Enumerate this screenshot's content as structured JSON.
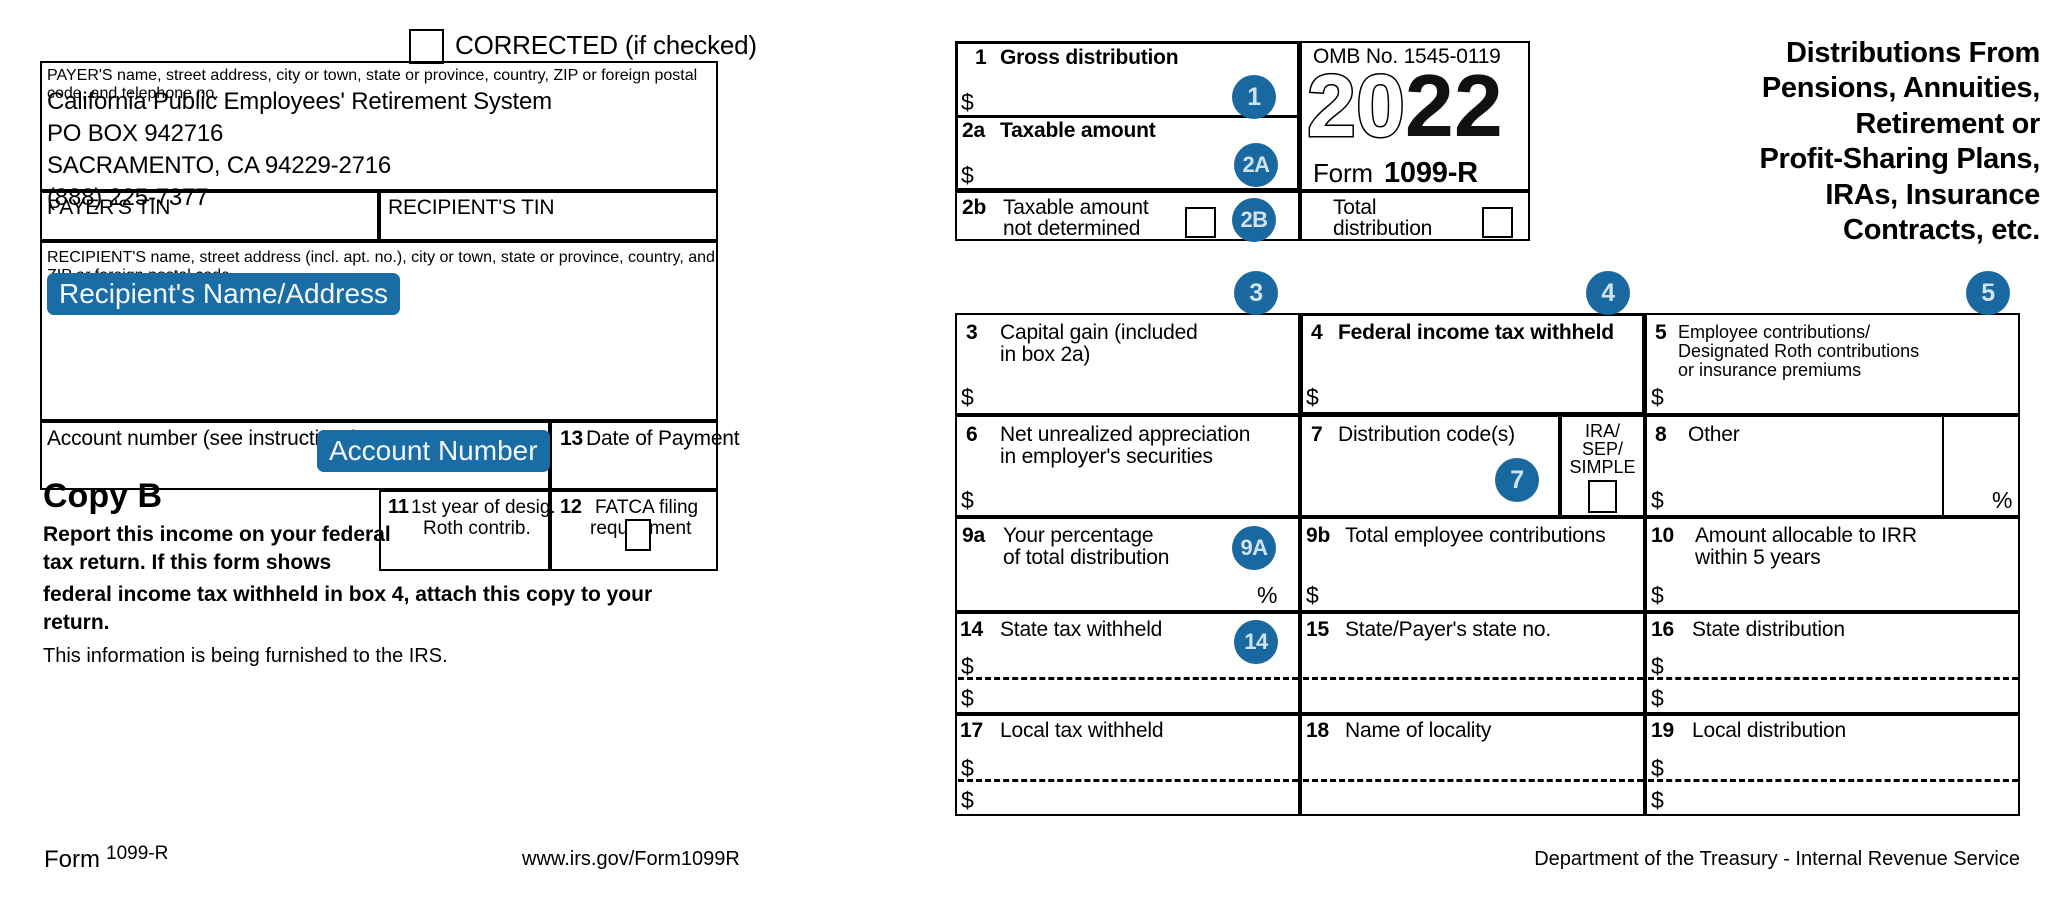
{
  "form": {
    "corrected_label": "CORRECTED (if checked)",
    "omb": "OMB No. 1545-0119",
    "year_hollow": "20",
    "year_solid": "22",
    "form_word": "Form",
    "form_number": "1099-R",
    "title_lines": [
      "Distributions From",
      "Pensions, Annuities,",
      "Retirement or",
      "Profit-Sharing Plans,",
      "IRAs, Insurance",
      "Contracts, etc."
    ]
  },
  "payer": {
    "caption": "PAYER'S name, street address, city or town, state or province, country, ZIP or foreign postal code, and telephone no.",
    "lines": [
      "California Public Employees' Retirement System",
      "PO BOX 942716",
      "SACRAMENTO, CA 94229-2716",
      "(888) 225-7377"
    ],
    "tin_label": "PAYER'S TIN",
    "tin_value": ""
  },
  "recipient": {
    "tin_label": "RECIPIENT'S TIN",
    "tin_value": "",
    "caption": "RECIPIENT'S name, street address (incl. apt. no.), city or town, state or province, country, and ZIP or foreign postal code",
    "name_address_chip": "Recipient's Name/Address",
    "account_label": "Account number (see instructions)",
    "account_chip": "Account Number"
  },
  "boxes": {
    "b1": {
      "num": "1",
      "label": "Gross distribution",
      "value": "",
      "dollar": "$",
      "badge": "1"
    },
    "b2a": {
      "num": "2a",
      "label": "Taxable amount",
      "value": "",
      "dollar": "$",
      "badge": "2A"
    },
    "b2b": {
      "num": "2b",
      "label_l1": "Taxable amount",
      "label_l2": "not determined",
      "checked": false,
      "badge": "2B"
    },
    "b2b_total": {
      "label_l1": "Total",
      "label_l2": "distribution",
      "checked": false
    },
    "b3": {
      "num": "3",
      "label_l1": "Capital gain (included",
      "label_l2": "in box 2a)",
      "value": "",
      "dollar": "$",
      "badge": "3"
    },
    "b4": {
      "num": "4",
      "label": "Federal income tax withheld",
      "value": "",
      "dollar": "$",
      "badge": "4"
    },
    "b5": {
      "num": "5",
      "label_l1": "Employee contributions/",
      "label_l2": "Designated Roth contributions",
      "label_l3": "or insurance premiums",
      "value": "",
      "dollar": "$",
      "badge": "5"
    },
    "b6": {
      "num": "6",
      "label_l1": "Net unrealized appreciation",
      "label_l2": "in employer's securities",
      "value": "",
      "dollar": "$"
    },
    "b7": {
      "num": "7",
      "label": "Distribution code(s)",
      "value": "",
      "badge": "7"
    },
    "b7_ira": {
      "label_l1": "IRA/",
      "label_l2": "SEP/",
      "label_l3": "SIMPLE",
      "checked": false
    },
    "b8": {
      "num": "8",
      "label": "Other",
      "value": "",
      "dollar": "$",
      "percent": "%",
      "percent_value": ""
    },
    "b9a": {
      "num": "9a",
      "label_l1": "Your percentage",
      "label_l2": "of total distribution",
      "value": "",
      "percent": "%",
      "badge": "9A"
    },
    "b9b": {
      "num": "9b",
      "label": "Total employee contributions",
      "value": "",
      "dollar": "$"
    },
    "b10": {
      "num": "10",
      "label_l1": "Amount allocable to IRR",
      "label_l2": "within 5 years",
      "value": "",
      "dollar": "$"
    },
    "b11": {
      "num": "11",
      "label_l1": "1st year of desig.",
      "label_l2": "Roth contrib.",
      "value": ""
    },
    "b12": {
      "num": "12",
      "label_l1": "FATCA filing",
      "label_l2": "requirement",
      "checked": false
    },
    "b13": {
      "num": "13",
      "label": "Date of Payment",
      "value": ""
    },
    "b14": {
      "num": "14",
      "label": "State tax withheld",
      "dollar": "$",
      "value_1": "",
      "value_2": "",
      "badge": "14"
    },
    "b15": {
      "num": "15",
      "label": "State/Payer's state no.",
      "value_1": "",
      "value_2": ""
    },
    "b16": {
      "num": "16",
      "label": "State distribution",
      "dollar": "$",
      "value_1": "",
      "value_2": ""
    },
    "b17": {
      "num": "17",
      "label": "Local tax withheld",
      "dollar": "$",
      "value_1": "",
      "value_2": ""
    },
    "b18": {
      "num": "18",
      "label": "Name of locality",
      "value_1": "",
      "value_2": ""
    },
    "b19": {
      "num": "19",
      "label": "Local distribution",
      "dollar": "$",
      "value_1": "",
      "value_2": ""
    }
  },
  "copy_b": {
    "heading": "Copy B",
    "line1": "Report this income on your federal",
    "line2": "tax return. If this form shows",
    "line3": "federal income tax withheld in box 4, attach this copy to your return.",
    "line4": "This information is being furnished to the IRS."
  },
  "footer": {
    "form_word": "Form",
    "form_number": "1099-R",
    "url": "www.irs.gov/Form1099R",
    "dept": "Department of the Treasury - Internal Revenue Service"
  },
  "colors": {
    "badge_blue": "#19689f",
    "chip_blue": "#1a6ca4"
  }
}
